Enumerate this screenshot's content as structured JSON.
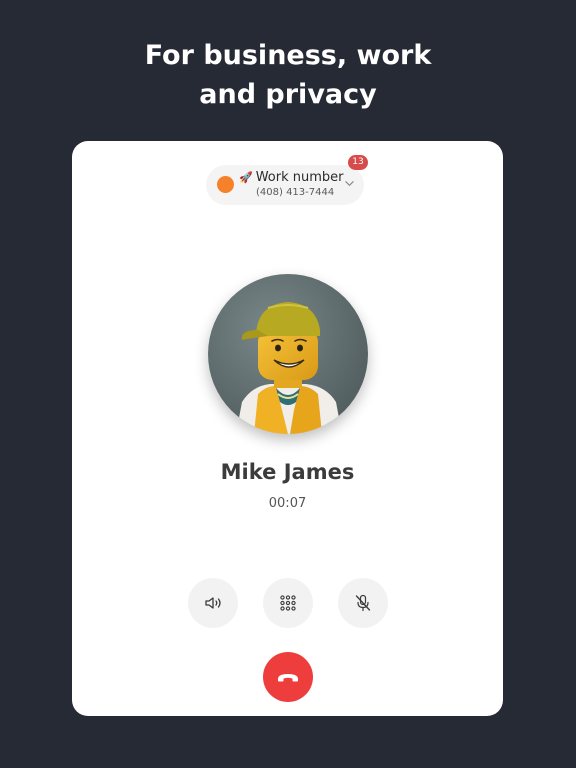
{
  "headline": {
    "line1": "For business, work",
    "line2": "and privacy"
  },
  "phone_line": {
    "name": "Work number",
    "emoji": "🚀",
    "number": "(408) 413-7444",
    "unread_count": "13",
    "dot_color": "#f5822a",
    "badge_color": "#d84b4b"
  },
  "contact": {
    "name": "Mike James"
  },
  "call": {
    "duration": "00:07"
  },
  "controls": {
    "speaker_icon": "speaker-icon",
    "keypad_icon": "keypad-icon",
    "mute_icon": "microphone-muted-icon",
    "hangup_icon": "phone-hangup-icon",
    "hangup_color": "#ee3d3d"
  },
  "colors": {
    "background": "#262a35",
    "card": "#ffffff"
  }
}
